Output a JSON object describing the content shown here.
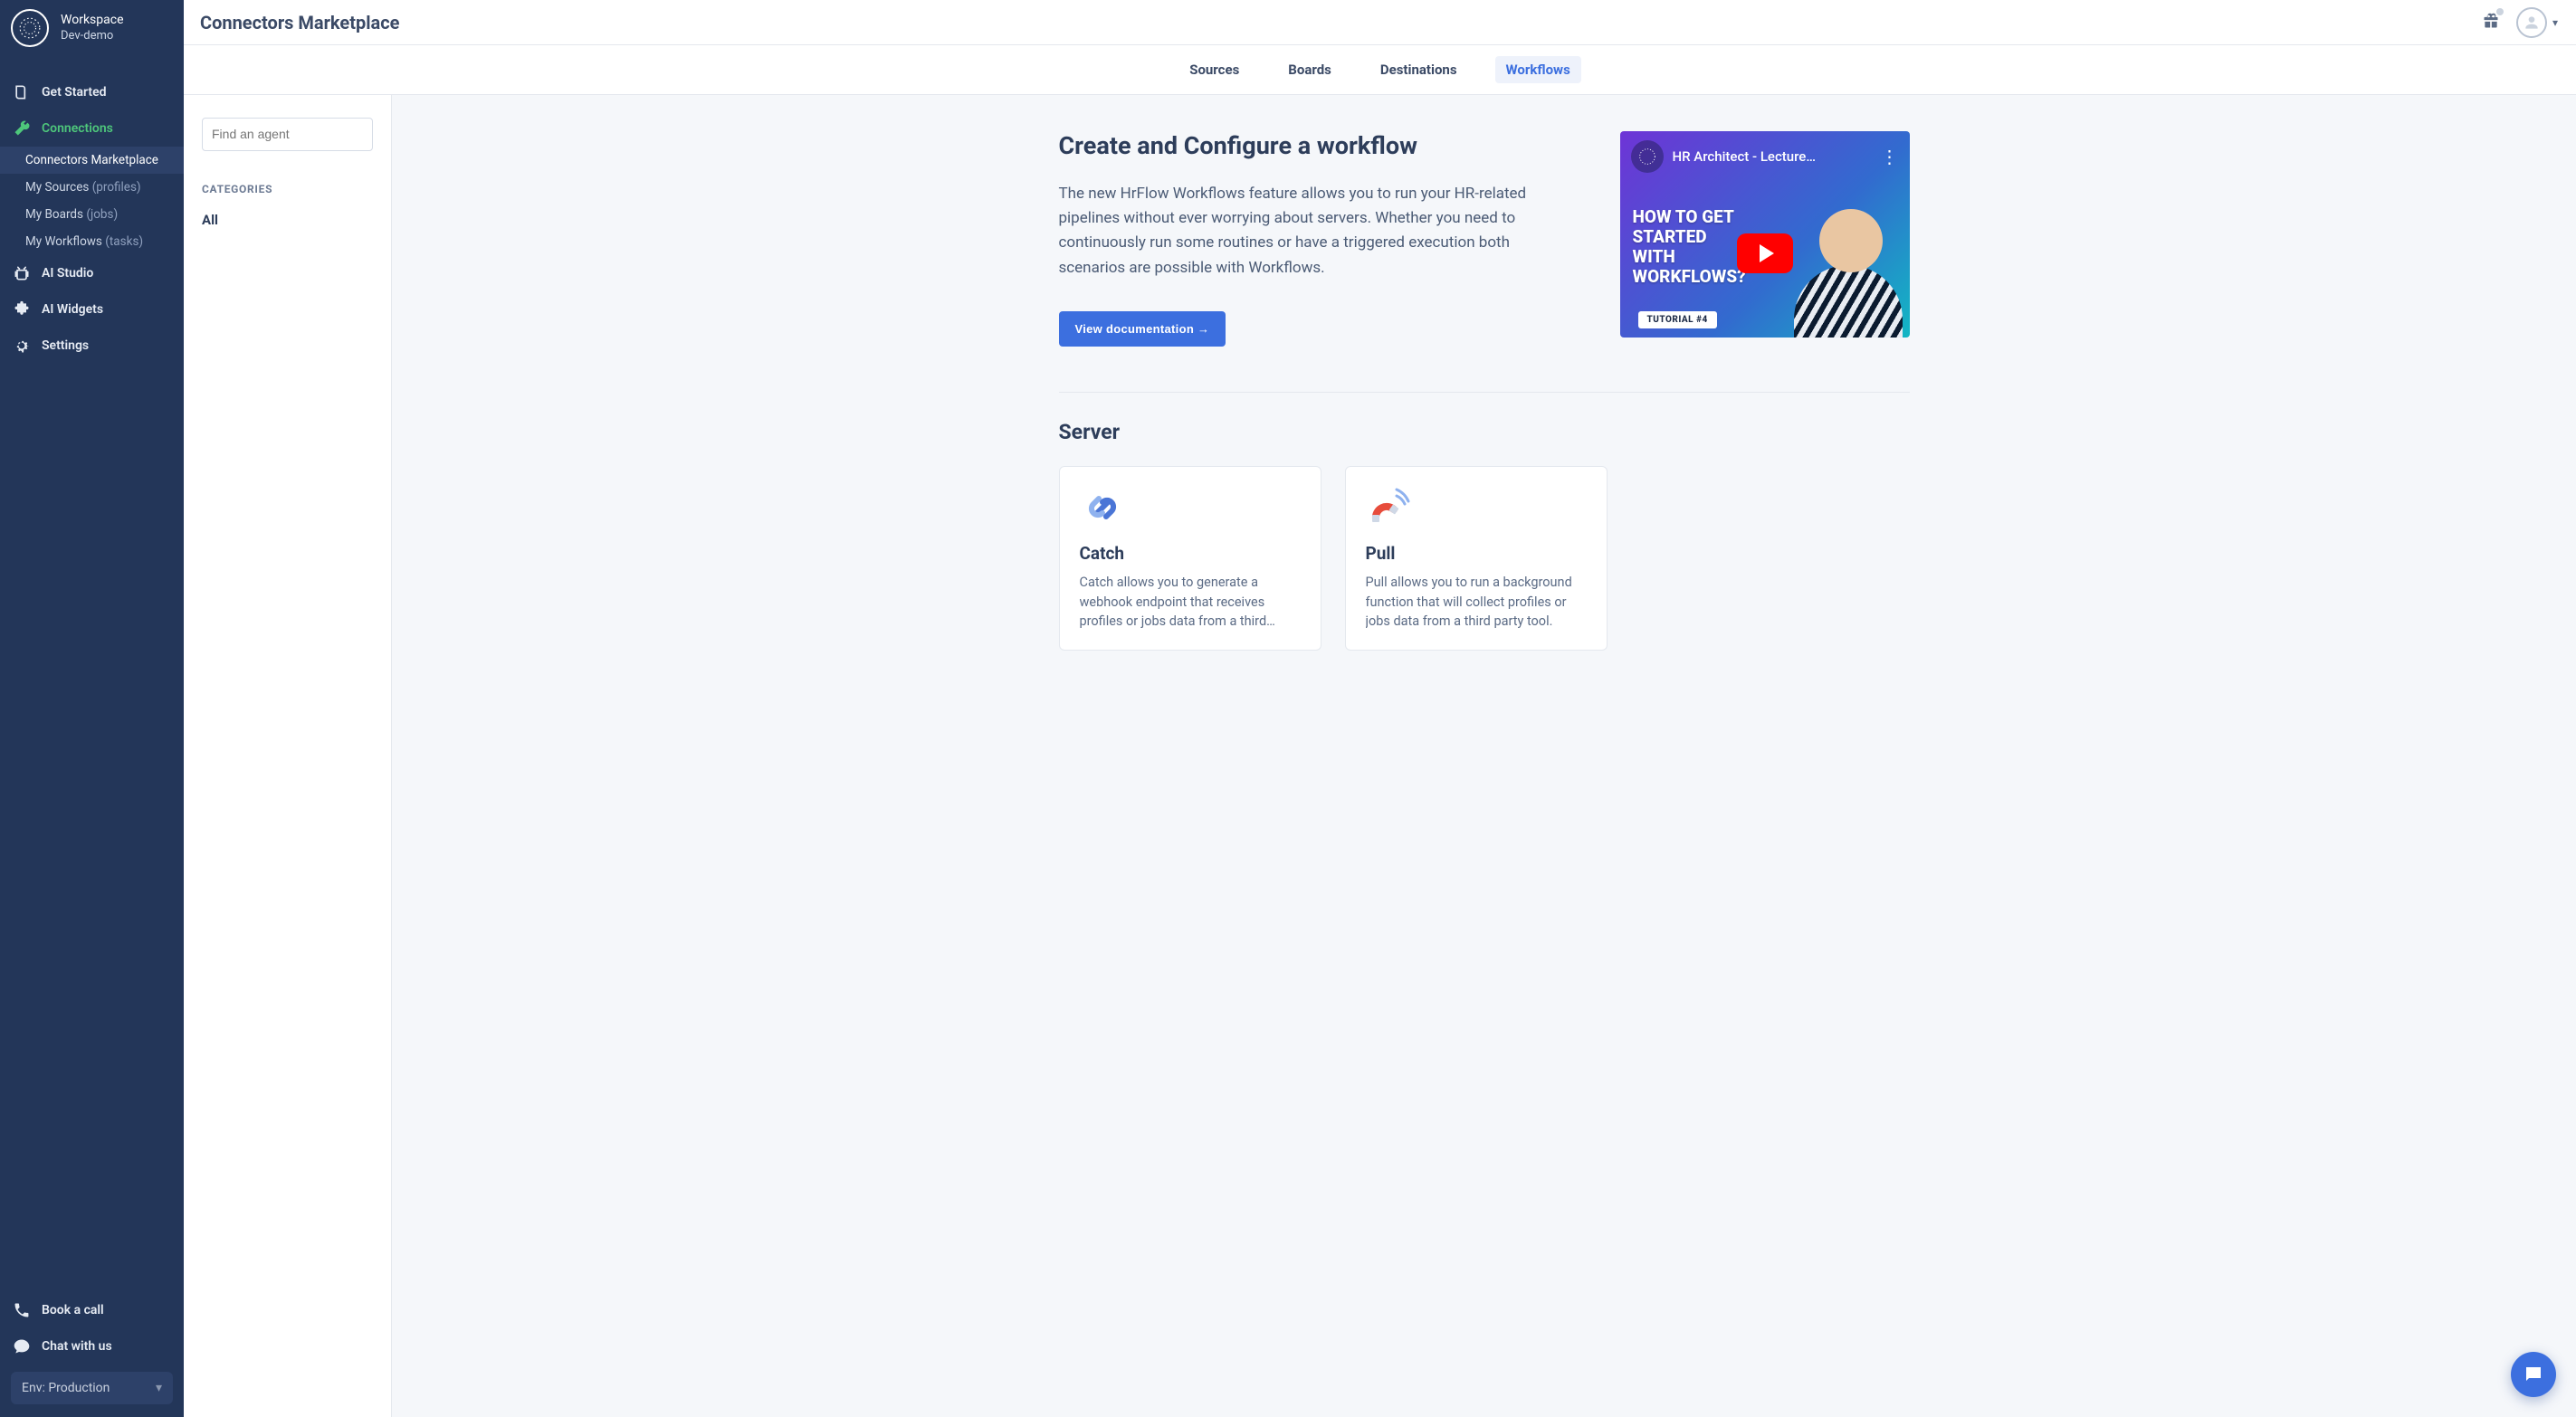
{
  "workspace": {
    "label": "Workspace",
    "name": "Dev-demo"
  },
  "sidebar": {
    "items": [
      {
        "label": "Get Started"
      },
      {
        "label": "Connections"
      },
      {
        "label": "AI Studio"
      },
      {
        "label": "AI Widgets"
      },
      {
        "label": "Settings"
      }
    ],
    "connections_sub": [
      {
        "label": "Connectors Marketplace",
        "suffix": ""
      },
      {
        "label": "My Sources",
        "suffix": "(profiles)"
      },
      {
        "label": "My Boards",
        "suffix": "(jobs)"
      },
      {
        "label": "My Workflows",
        "suffix": "(tasks)"
      }
    ],
    "bottom": {
      "book": "Book a call",
      "chat": "Chat with us"
    },
    "env": "Env: Production"
  },
  "page": {
    "title": "Connectors Marketplace"
  },
  "tabs": [
    {
      "label": "Sources"
    },
    {
      "label": "Boards"
    },
    {
      "label": "Destinations"
    },
    {
      "label": "Workflows"
    }
  ],
  "filter": {
    "search_placeholder": "Find an agent",
    "categories_label": "CATEGORIES",
    "cats": [
      {
        "label": "All"
      }
    ]
  },
  "intro": {
    "heading": "Create and Configure a workflow",
    "body": "The new HrFlow Workflows feature allows you to run your HR-related pipelines without ever worrying about servers. Whether you need to continuously run some routines or have a triggered execution both scenarios are possible with Workflows.",
    "button": "View documentation →"
  },
  "video": {
    "title": "HR Architect - Lecture…",
    "howto_line1": "HOW TO GET",
    "howto_line2": "STARTED",
    "howto_line3": "WITH",
    "howto_line4": "WORKFLOWS?",
    "tutorial": "TUTORIAL #4"
  },
  "section": {
    "title": "Server",
    "cards": [
      {
        "title": "Catch",
        "desc": "Catch allows you to generate a webhook endpoint that receives profiles or jobs data from a third part…"
      },
      {
        "title": "Pull",
        "desc": "Pull allows you to run a background function that will collect profiles or jobs data from a third party tool."
      }
    ]
  }
}
